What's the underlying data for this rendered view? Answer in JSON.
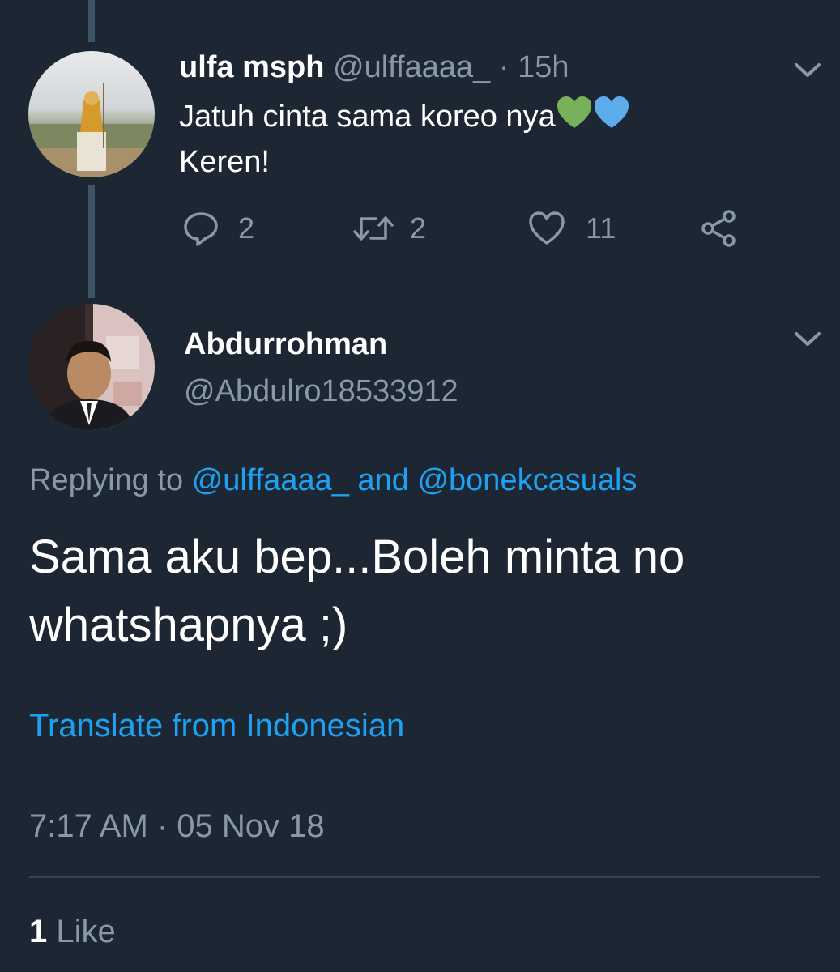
{
  "parent_tweet": {
    "display_name": "ulfa msph",
    "handle": "@ulffaaaa_",
    "separator": "·",
    "time": "15h",
    "text_line1": "Jatuh cinta sama koreo nya",
    "text_line2": "Keren!",
    "emojis": [
      "green-heart",
      "blue-heart"
    ],
    "actions": {
      "reply_count": "2",
      "retweet_count": "2",
      "like_count": "11"
    }
  },
  "main_tweet": {
    "display_name": "Abdurrohman",
    "handle": "@Abdulro18533912",
    "replying_prefix": "Replying to",
    "replying_user1": "@ulffaaaa_",
    "replying_and": "and",
    "replying_user2": "@bonekcasuals",
    "text_line1": "Sama aku bep...Boleh minta no",
    "text_line2": "whatshapnya ;)",
    "translate_label": "Translate from Indonesian",
    "timestamp": "7:17 AM · 05 Nov 18",
    "likes_count": "1",
    "likes_label": "Like"
  },
  "colors": {
    "background": "#1c2733",
    "link": "#1da1f2",
    "muted": "#8899a6",
    "thread_line": "#3d5466",
    "divider": "#38444d"
  },
  "icons": [
    "chevron-down-icon",
    "reply-icon",
    "retweet-icon",
    "like-icon",
    "share-icon"
  ]
}
